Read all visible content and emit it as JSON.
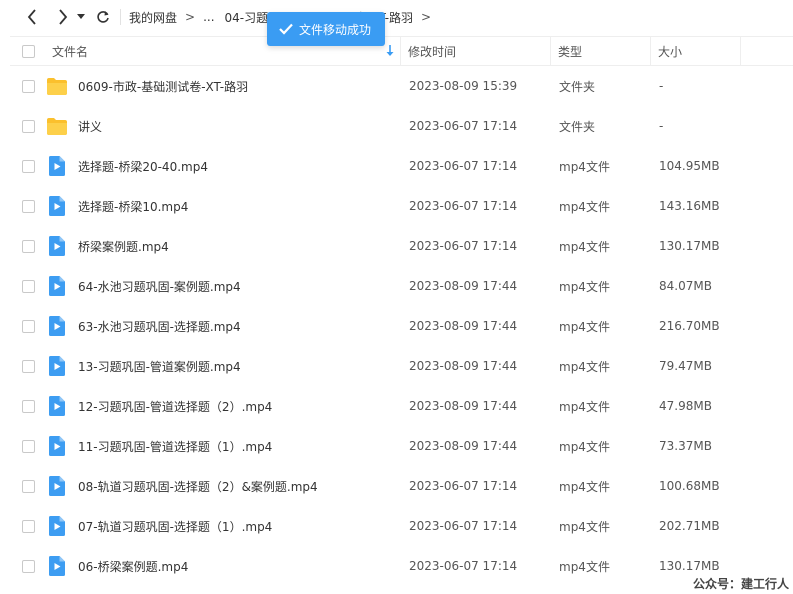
{
  "toolbar": {
    "back_icon": "chevron-left-icon",
    "forward_icon": "chevron-right-icon",
    "dropdown_icon": "caret-down-icon",
    "refresh_icon": "refresh-icon"
  },
  "breadcrumb": {
    "root": "我的网盘",
    "ellipsis": "...",
    "level1": "04-习题",
    "level2": "习题班-XT-路羽",
    "separator": ">"
  },
  "toast": {
    "text": "文件移动成功",
    "icon": "check-icon",
    "color": "#3a9cf3"
  },
  "table": {
    "headers": {
      "name": "文件名",
      "time": "修改时间",
      "type": "类型",
      "size": "大小"
    },
    "sort_icon": "sort-down-arrow-icon",
    "rows": [
      {
        "icon": "folder",
        "name": "0609-市政-基础测试卷-XT-路羽",
        "time": "2023-08-09 15:39",
        "type": "文件夹",
        "size": "-"
      },
      {
        "icon": "folder",
        "name": "讲义",
        "time": "2023-06-07 17:14",
        "type": "文件夹",
        "size": "-"
      },
      {
        "icon": "video",
        "name": "选择题-桥梁20-40.mp4",
        "time": "2023-06-07 17:14",
        "type": "mp4文件",
        "size": "104.95MB"
      },
      {
        "icon": "video",
        "name": "选择题-桥梁10.mp4",
        "time": "2023-06-07 17:14",
        "type": "mp4文件",
        "size": "143.16MB"
      },
      {
        "icon": "video",
        "name": "桥梁案例题.mp4",
        "time": "2023-06-07 17:14",
        "type": "mp4文件",
        "size": "130.17MB"
      },
      {
        "icon": "video",
        "name": "64-水池习题巩固-案例题.mp4",
        "time": "2023-08-09 17:44",
        "type": "mp4文件",
        "size": "84.07MB"
      },
      {
        "icon": "video",
        "name": "63-水池习题巩固-选择题.mp4",
        "time": "2023-08-09 17:44",
        "type": "mp4文件",
        "size": "216.70MB"
      },
      {
        "icon": "video",
        "name": "13-习题巩固-管道案例题.mp4",
        "time": "2023-08-09 17:44",
        "type": "mp4文件",
        "size": "79.47MB"
      },
      {
        "icon": "video",
        "name": "12-习题巩固-管道选择题（2）.mp4",
        "time": "2023-08-09 17:44",
        "type": "mp4文件",
        "size": "47.98MB"
      },
      {
        "icon": "video",
        "name": "11-习题巩固-管道选择题（1）.mp4",
        "time": "2023-08-09 17:44",
        "type": "mp4文件",
        "size": "73.37MB"
      },
      {
        "icon": "video",
        "name": "08-轨道习题巩固-选择题（2）&案例题.mp4",
        "time": "2023-06-07 17:14",
        "type": "mp4文件",
        "size": "100.68MB"
      },
      {
        "icon": "video",
        "name": "07-轨道习题巩固-选择题（1）.mp4",
        "time": "2023-06-07 17:14",
        "type": "mp4文件",
        "size": "202.71MB"
      },
      {
        "icon": "video",
        "name": "06-桥梁案例题.mp4",
        "time": "2023-06-07 17:14",
        "type": "mp4文件",
        "size": "130.17MB"
      }
    ]
  },
  "watermark": "公众号：建工行人",
  "colors": {
    "folder": "#fbc02d",
    "video": "#3d9df2",
    "accent": "#3a9cf3"
  }
}
